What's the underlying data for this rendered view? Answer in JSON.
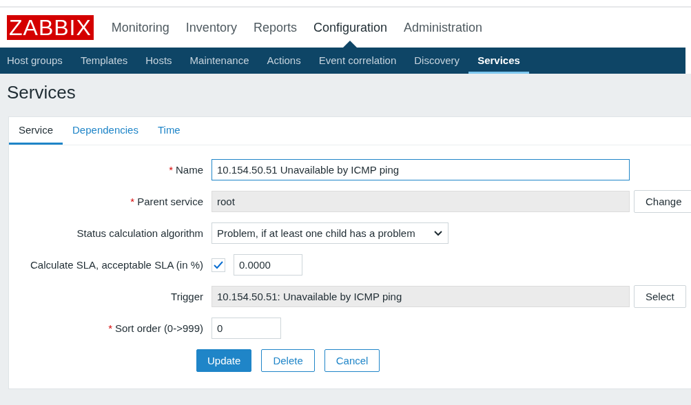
{
  "header": {
    "logo": "ZABBIX",
    "menu": [
      {
        "label": "Monitoring",
        "selected": false
      },
      {
        "label": "Inventory",
        "selected": false
      },
      {
        "label": "Reports",
        "selected": false
      },
      {
        "label": "Configuration",
        "selected": true
      },
      {
        "label": "Administration",
        "selected": false
      }
    ]
  },
  "submenu": [
    {
      "label": "Host groups",
      "selected": false
    },
    {
      "label": "Templates",
      "selected": false
    },
    {
      "label": "Hosts",
      "selected": false
    },
    {
      "label": "Maintenance",
      "selected": false
    },
    {
      "label": "Actions",
      "selected": false
    },
    {
      "label": "Event correlation",
      "selected": false
    },
    {
      "label": "Discovery",
      "selected": false
    },
    {
      "label": "Services",
      "selected": true
    }
  ],
  "page_title": "Services",
  "tabs": [
    {
      "label": "Service",
      "selected": true
    },
    {
      "label": "Dependencies",
      "selected": false
    },
    {
      "label": "Time",
      "selected": false
    }
  ],
  "form": [
    {
      "kind": "text",
      "marker": "*",
      "label": "Name",
      "value": "10.154.50.51 Unavailable by ICMP ping"
    },
    {
      "kind": "picker",
      "marker": "*",
      "label": "Parent service",
      "value": "root",
      "button": "Change"
    },
    {
      "kind": "select",
      "label": "Status calculation algorithm",
      "value": "Problem, if at least one child has a problem"
    },
    {
      "kind": "checkbox",
      "label": "Calculate SLA, acceptable SLA (in %)",
      "checked": true,
      "value": "0.0000"
    },
    {
      "kind": "picker",
      "label": "Trigger",
      "value": "10.154.50.51: Unavailable by ICMP ping",
      "button": "Select"
    },
    {
      "kind": "short",
      "marker": "*",
      "label": "Sort order (0->999)",
      "value": "0"
    }
  ],
  "buttons": [
    {
      "label": "Update",
      "kind": "primary"
    },
    {
      "label": "Delete",
      "kind": "secondary"
    },
    {
      "label": "Cancel",
      "kind": "secondary"
    }
  ]
}
